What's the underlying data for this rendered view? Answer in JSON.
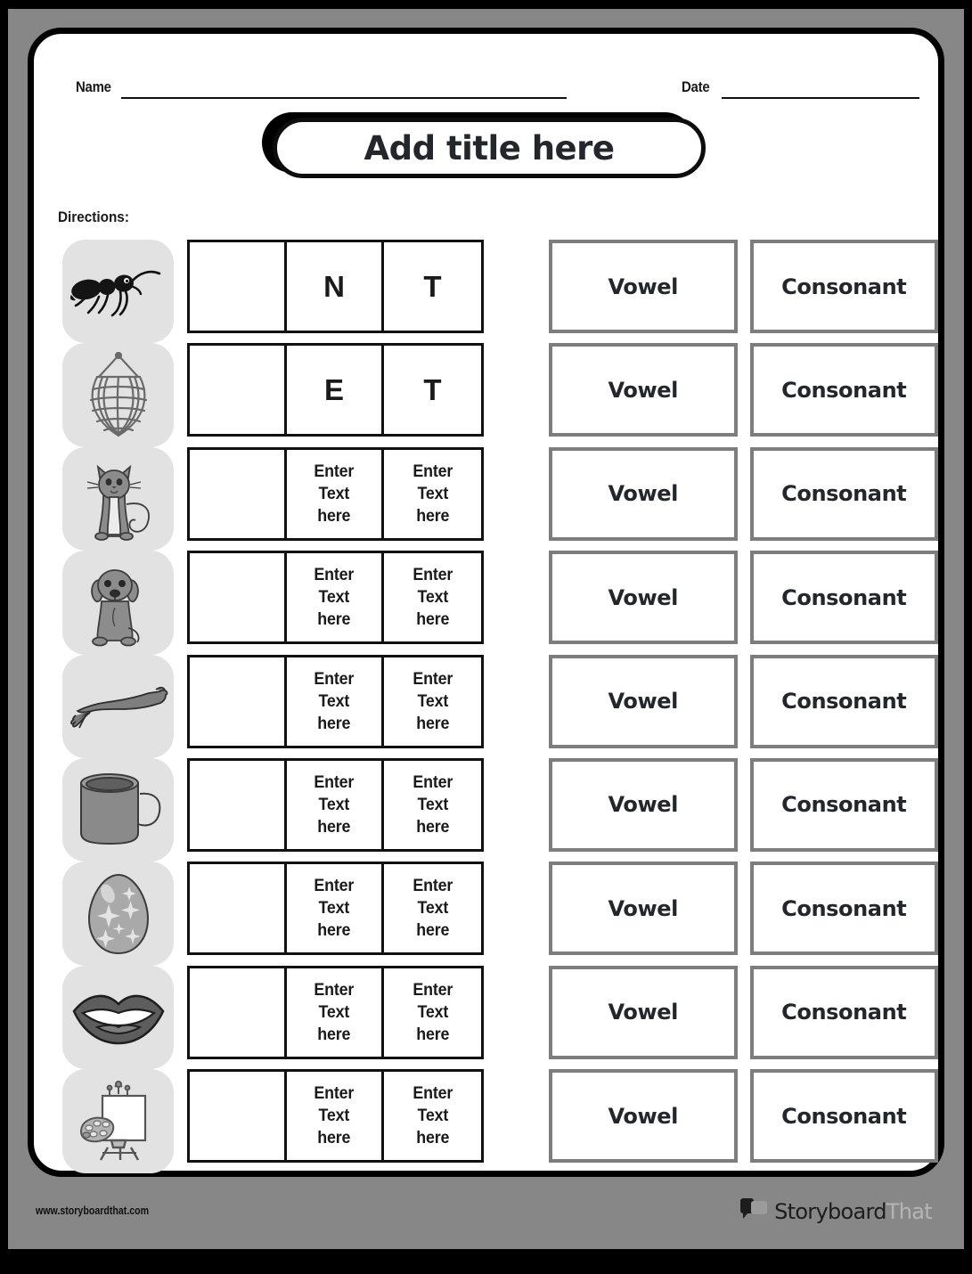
{
  "page": {
    "title_placeholder": "Add title here",
    "name_label": "Name",
    "date_label": "Date",
    "directions_label": "Directions:",
    "name_value": "",
    "date_value": ""
  },
  "colors": {
    "outer_background": "#000000",
    "page_margin": "#878787",
    "sheet": "#ffffff",
    "border": "#000000",
    "image_tile": "#e2e2e2",
    "choice_border": "#7d7d7d",
    "text": "#23272b",
    "footer_band": "#c9c9c9"
  },
  "grid": {
    "columns": 3,
    "rows": [
      {
        "image": "ant-icon",
        "cells": [
          "",
          "N",
          "T"
        ]
      },
      {
        "image": "net-icon",
        "cells": [
          "",
          "E",
          "T"
        ]
      },
      {
        "image": "cat-icon",
        "cells": [
          "",
          "Enter Text here",
          "Enter Text here"
        ]
      },
      {
        "image": "dog-icon",
        "cells": [
          "",
          "Enter Text here",
          "Enter Text here"
        ]
      },
      {
        "image": "arm-icon",
        "cells": [
          "",
          "Enter Text here",
          "Enter Text here"
        ]
      },
      {
        "image": "mug-icon",
        "cells": [
          "",
          "Enter Text here",
          "Enter Text here"
        ]
      },
      {
        "image": "egg-icon",
        "cells": [
          "",
          "Enter Text here",
          "Enter Text here"
        ]
      },
      {
        "image": "lips-icon",
        "cells": [
          "",
          "Enter Text here",
          "Enter Text here"
        ]
      },
      {
        "image": "easel-icon",
        "cells": [
          "",
          "Enter Text here",
          "Enter Text here"
        ]
      }
    ]
  },
  "choices": {
    "option_a": "Vowel",
    "option_b": "Consonant",
    "rows": [
      {
        "a": "Vowel",
        "b": "Consonant"
      },
      {
        "a": "Vowel",
        "b": "Consonant"
      },
      {
        "a": "Vowel",
        "b": "Consonant"
      },
      {
        "a": "Vowel",
        "b": "Consonant"
      },
      {
        "a": "Vowel",
        "b": "Consonant"
      },
      {
        "a": "Vowel",
        "b": "Consonant"
      },
      {
        "a": "Vowel",
        "b": "Consonant"
      },
      {
        "a": "Vowel",
        "b": "Consonant"
      },
      {
        "a": "Vowel",
        "b": "Consonant"
      }
    ]
  },
  "footer": {
    "url": "www.storyboardthat.com",
    "brand_primary": "Storyboard",
    "brand_secondary": "That"
  }
}
